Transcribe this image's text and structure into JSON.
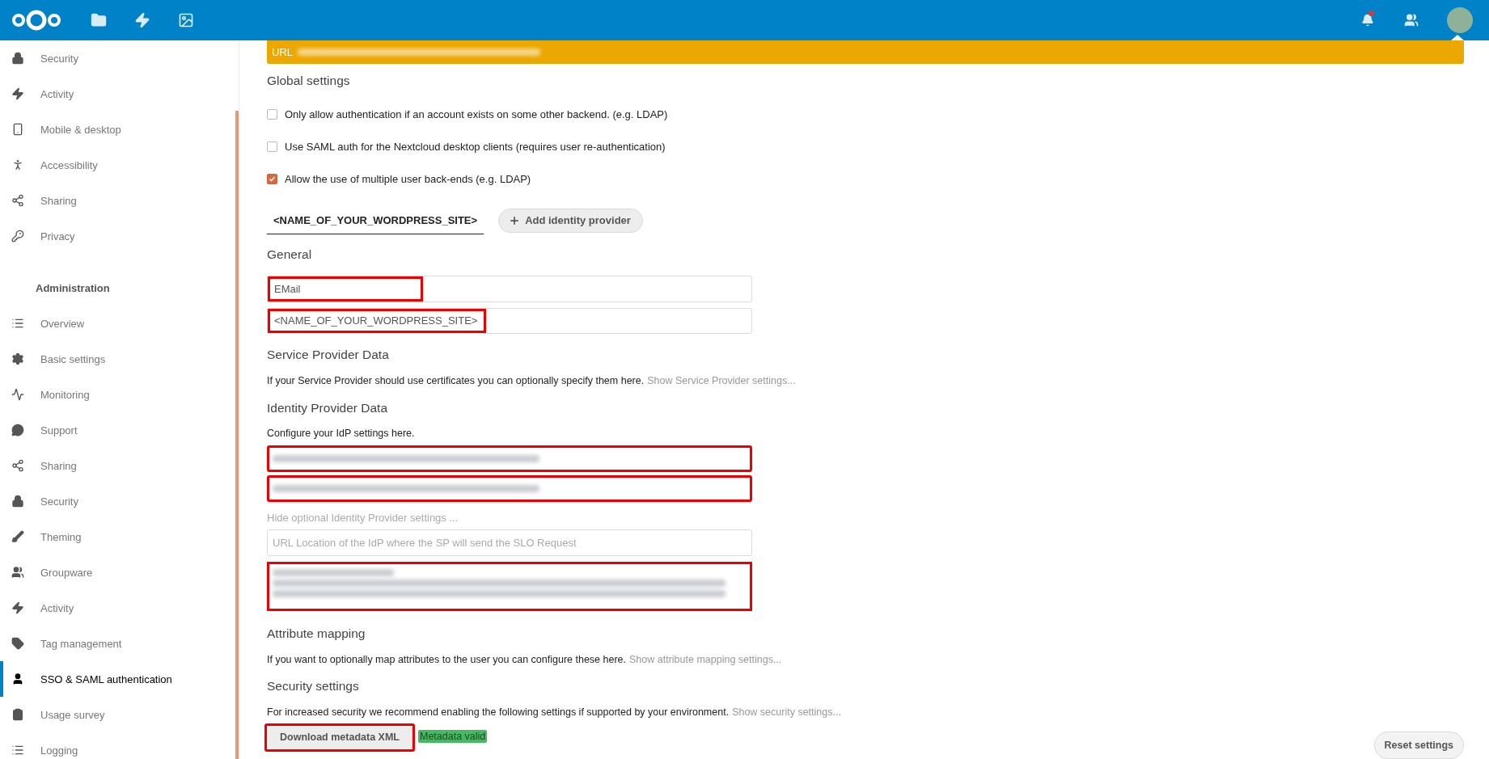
{
  "sidebar": {
    "sections": [
      {
        "items": [
          {
            "label": "Security",
            "selected": false
          },
          {
            "label": "Activity",
            "selected": false
          },
          {
            "label": "Mobile & desktop",
            "selected": false
          },
          {
            "label": "Accessibility",
            "selected": false
          },
          {
            "label": "Sharing",
            "selected": false
          },
          {
            "label": "Privacy",
            "selected": false
          }
        ]
      },
      {
        "heading": "Administration",
        "items": [
          {
            "label": "Overview",
            "selected": false
          },
          {
            "label": "Basic settings",
            "selected": false
          },
          {
            "label": "Monitoring",
            "selected": false
          },
          {
            "label": "Support",
            "selected": false
          },
          {
            "label": "Sharing",
            "selected": false
          },
          {
            "label": "Security",
            "selected": false
          },
          {
            "label": "Theming",
            "selected": false
          },
          {
            "label": "Groupware",
            "selected": false
          },
          {
            "label": "Activity",
            "selected": false
          },
          {
            "label": "Tag management",
            "selected": false
          },
          {
            "label": "SSO & SAML authentication",
            "selected": true
          },
          {
            "label": "Usage survey",
            "selected": false
          },
          {
            "label": "Logging",
            "selected": false
          }
        ]
      }
    ]
  },
  "banner": {
    "label": "URL",
    "redacted": true
  },
  "global_settings": {
    "title": "Global settings",
    "options": [
      {
        "label": "Only allow authentication if an account exists on some other backend. (e.g. LDAP)",
        "checked": false
      },
      {
        "label": "Use SAML auth for the Nextcloud desktop clients (requires user re-authentication)",
        "checked": false
      },
      {
        "label": "Allow the use of multiple user back-ends (e.g. LDAP)",
        "checked": true
      }
    ]
  },
  "tabs": [
    {
      "label": "<NAME_OF_YOUR_WORDPRESS_SITE>",
      "selected": true
    }
  ],
  "add_provider_button": "Add identity provider",
  "general": {
    "title": "General",
    "fields": [
      {
        "value": "EMail",
        "highlighted": true
      },
      {
        "value": "<NAME_OF_YOUR_WORDPRESS_SITE>",
        "highlighted": true
      }
    ]
  },
  "service_provider": {
    "title": "Service Provider Data",
    "text": "If your Service Provider should use certificates you can optionally specify them here.",
    "link": "Show Service Provider settings..."
  },
  "identity_provider": {
    "title": "Identity Provider Data",
    "text": "Configure your IdP settings here.",
    "fields": [
      {
        "redacted": true,
        "highlighted": true
      },
      {
        "redacted": true,
        "highlighted": true
      }
    ],
    "toggle_link": "Hide optional Identity Provider settings ...",
    "optional_fields": [
      {
        "kind": "input",
        "placeholder": "URL Location of the IdP where the SP will send the SLO Request",
        "highlighted": false
      },
      {
        "kind": "textarea",
        "redacted": true,
        "highlighted": true
      }
    ]
  },
  "attribute_mapping": {
    "title": "Attribute mapping",
    "text": "If you want to optionally map attributes to the user you can configure these here.",
    "link": "Show attribute mapping settings..."
  },
  "security_settings": {
    "title": "Security settings",
    "text": "For increased security we recommend enabling the following settings if supported by your environment.",
    "link": "Show security settings..."
  },
  "actions": {
    "download": {
      "label": "Download metadata XML",
      "highlighted": true
    },
    "status": "Metadata valid",
    "reset": "Reset settings"
  }
}
